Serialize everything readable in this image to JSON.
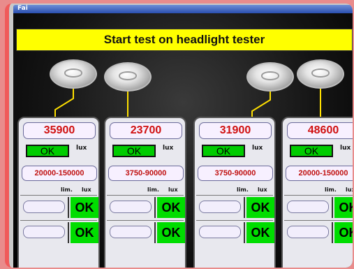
{
  "window": {
    "title": "Fai"
  },
  "banner": {
    "text": "Start test on headlight tester"
  },
  "panels": [
    {
      "value": "35900",
      "status": "OK",
      "lux_label": "lux",
      "range": "20000-150000",
      "lim_label": "lim.",
      "lux_col_label": "lux",
      "rows": [
        {
          "ok": "OK"
        },
        {
          "ok": "OK"
        }
      ]
    },
    {
      "value": "23700",
      "status": "OK",
      "lux_label": "lux",
      "range": "3750-90000",
      "lim_label": "lim.",
      "lux_col_label": "lux",
      "rows": [
        {
          "ok": "OK"
        },
        {
          "ok": "OK"
        }
      ]
    },
    {
      "value": "31900",
      "status": "OK",
      "lux_label": "lux",
      "range": "3750-90000",
      "lim_label": "lim.",
      "lux_col_label": "lux",
      "rows": [
        {
          "ok": "OK"
        },
        {
          "ok": "OK"
        }
      ]
    },
    {
      "value": "48600",
      "status": "OK",
      "lux_label": "lux",
      "range": "20000-150000",
      "lim_label": "lim.",
      "lux_col_label": "lux",
      "rows": [
        {
          "ok": "OK"
        },
        {
          "ok": "OK"
        }
      ]
    }
  ],
  "colors": {
    "ok_green": "#00dd00",
    "value_red": "#d01010",
    "banner_yellow": "#ffff00"
  }
}
